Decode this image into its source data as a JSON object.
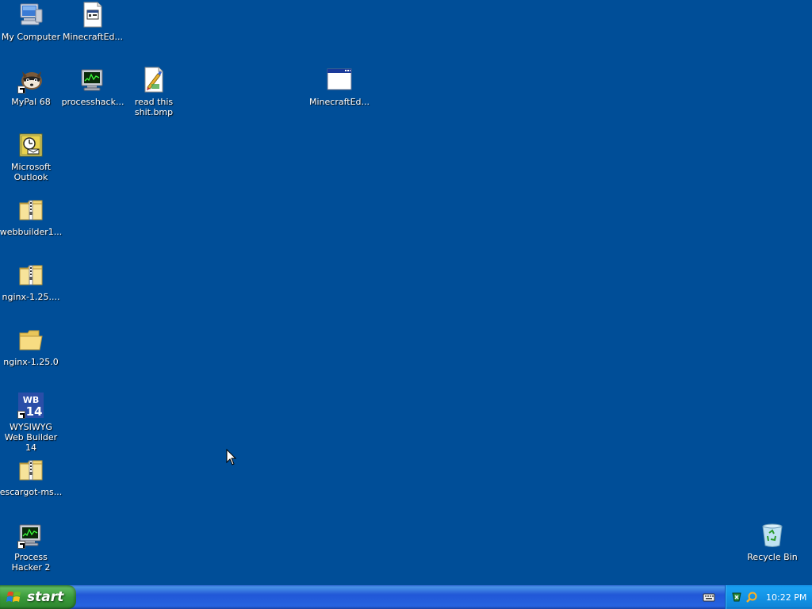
{
  "desktop": {
    "background_color": "#004e98",
    "icons": {
      "my_computer": {
        "label": "My Computer",
        "icon": "computer-icon"
      },
      "minecraft_ed_1": {
        "label": "MinecraftEd...",
        "icon": "application-file-icon"
      },
      "mypal": {
        "label": "MyPal 68",
        "icon": "raccoon-browser-icon"
      },
      "processhacker_file": {
        "label": "processhack...",
        "icon": "process-monitor-icon"
      },
      "read_this": {
        "label": "read this shit.bmp",
        "icon": "bitmap-image-icon"
      },
      "minecraft_ed_2": {
        "label": "MinecraftEd...",
        "icon": "window-application-icon"
      },
      "outlook": {
        "label": "Microsoft Outlook",
        "icon": "outlook-icon"
      },
      "webbuilder_zip": {
        "label": "webbuilder1...",
        "icon": "zip-folder-icon"
      },
      "nginx_zip": {
        "label": "nginx-1.25....",
        "icon": "zip-folder-icon"
      },
      "nginx_folder": {
        "label": "nginx-1.25.0",
        "icon": "folder-icon"
      },
      "wysiwyg": {
        "label": "WYSIWYG Web Builder 14",
        "icon": "wb14-icon",
        "logo_text_top": "WB",
        "logo_text_bottom": "14"
      },
      "escargot_zip": {
        "label": "escargot-ms...",
        "icon": "zip-folder-icon"
      },
      "process_hacker": {
        "label": "Process Hacker 2",
        "icon": "process-monitor-icon"
      },
      "recycle_bin": {
        "label": "Recycle Bin",
        "icon": "recycle-bin-icon"
      }
    }
  },
  "taskbar": {
    "start_label": "start",
    "clock": "10:22 PM",
    "colors": {
      "taskbar": "#245edb",
      "start_button": "#3c9a3c",
      "tray": "#0f8ee3"
    }
  }
}
